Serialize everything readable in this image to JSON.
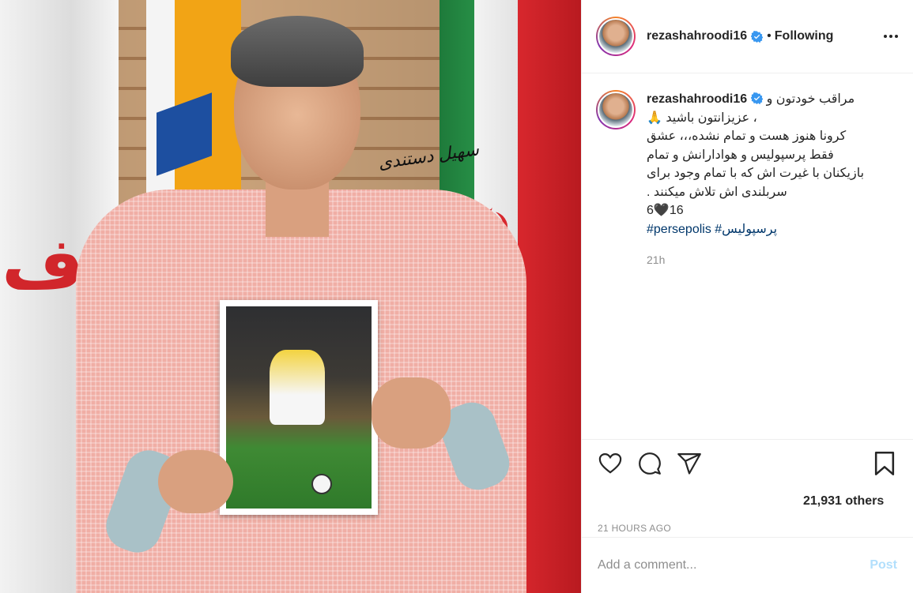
{
  "post": {
    "username": "rezashahroodi16",
    "follow_status": "Following",
    "separator": "•"
  },
  "caption": {
    "username": "rezashahroodi16",
    "lines": [
      "مراقب خودتون و",
      "🙏 عزیزانتون باشید ،",
      "کرونا هنوز هست و تمام نشده،،، عشق",
      "فقط پرسپولیس و هوادارانش و تمام",
      "بازیکنان با غیرت اش که با تمام وجود برای",
      ". سربلندی اش تلاش میکنند",
      "6🖤16"
    ],
    "hashtags": "#persepolis #پرسپولیس",
    "relative_time": "21h"
  },
  "engagement": {
    "likes_text": "21,931 others",
    "timestamp": "21 HOURS AGO"
  },
  "comment": {
    "placeholder": "Add a comment...",
    "post_label": "Post"
  },
  "photo": {
    "signature_text": "سهیل دستندی"
  },
  "colors": {
    "link": "#00376b",
    "muted": "#8e8e8e",
    "post_disabled": "#b2dffc",
    "verified": "#3897f0"
  },
  "icons": [
    "verified-badge-icon",
    "more-options-icon",
    "heart-icon",
    "comment-icon",
    "share-icon",
    "bookmark-icon"
  ]
}
